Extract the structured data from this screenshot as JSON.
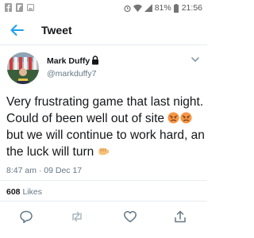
{
  "status_bar": {
    "battery": "81%",
    "time": "21:56"
  },
  "header": {
    "title": "Tweet",
    "back_icon": "arrow-left-icon"
  },
  "tweet": {
    "author": {
      "name": "Mark Duffy",
      "handle": "@markduffy7",
      "protected_icon": "lock-icon"
    },
    "text": {
      "part1": "Very frustrating game that last night. Could of been well out of site ",
      "part2": "but we will continue to work hard, an the luck will turn "
    },
    "emojis": [
      "angry-face-emoji",
      "angry-face-emoji",
      "oncoming-fist-emoji"
    ],
    "timestamp": "8:47 am · 09 Dec 17",
    "likes_count": "608",
    "likes_label": "Likes"
  },
  "actions": [
    "reply-icon",
    "retweet-icon",
    "like-icon",
    "share-icon"
  ],
  "colors": {
    "accent": "#1da1f2",
    "text": "#14171a",
    "secondary_text": "#657786",
    "divider": "#e6ecf0"
  }
}
